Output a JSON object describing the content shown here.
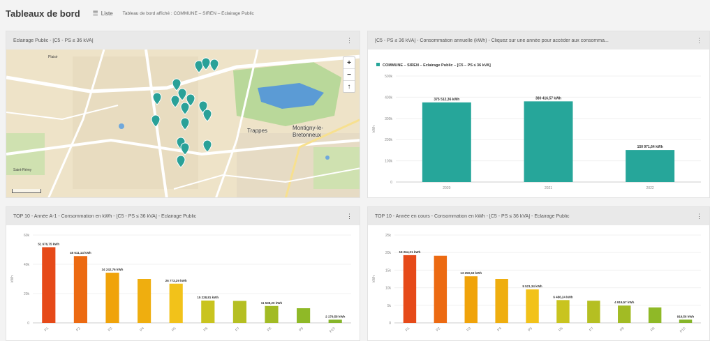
{
  "header": {
    "title": "Tableaux de bord",
    "list_icon": "list-icon",
    "list_label": "Liste",
    "breadcrumb": "Tableau de bord affiché : COMMUNE – SIREN – Eclairage Public"
  },
  "map_card": {
    "title": "Eclairage Public - [C5 - PS ≤ 36 kVA]",
    "zoom_in": "+",
    "zoom_out": "−",
    "reset": "↑",
    "places": {
      "trappes": "Trappes",
      "montigny": "Montigny-le-Bretonneux",
      "saint_remy": "Saint-Rémy",
      "plesis": "Plaisir"
    }
  },
  "annual_card": {
    "title": "[C5 - PS ≤ 36 kVA] - Consommation annuelle (kWh) - Cliquez sur une année pour accéder aux consomma...",
    "chart_data": {
      "type": "bar",
      "legend": "COMMUNE – SIREN – Eclairage Public – [C5 – PS ≤ 36 kVA]",
      "categories": [
        "2020",
        "2021",
        "2022"
      ],
      "values": [
        375512.36,
        380416.57,
        150971.64
      ],
      "labels": [
        "375 512,36 kWh",
        "380 416,57 kWh",
        "150 971,64 kWh"
      ],
      "ylabel": "kWh",
      "ylim": [
        0,
        500000
      ],
      "yticks": [
        "0",
        "100k",
        "200k",
        "300k",
        "400k",
        "500k"
      ],
      "color": "#26a69a"
    }
  },
  "top_prev_card": {
    "title": "TOP 10 - Année A-1 - Consommation en kWh - [C5 - PS ≤ 36 kVA] - Eclairage Public",
    "chart_data": {
      "type": "bar",
      "categories": [
        "P1",
        "P2",
        "P3",
        "P4",
        "P5",
        "P6",
        "P7",
        "P8",
        "P9",
        "P10"
      ],
      "values": [
        51676.75,
        45611.14,
        34242.76,
        30000,
        26773.29,
        15228.81,
        15000,
        11538.2,
        10000,
        2179.58
      ],
      "labels": [
        "51 676,75 kWh",
        "45 611,14 kWh",
        "34 242,76 kWh",
        "",
        "26 773,29 kWh",
        "15 228,81 kWh",
        "",
        "11 538,20 kWh",
        "",
        "2 179,58 kWh"
      ],
      "ylabel": "kWh",
      "ylim": [
        0,
        60000
      ],
      "yticks": [
        "0",
        "20k",
        "40k",
        "60k"
      ],
      "colors": [
        "#e64a19",
        "#ec6a12",
        "#f0a30a",
        "#efae0f",
        "#f2c21a",
        "#c9c41f",
        "#b5bf22",
        "#a2bb24",
        "#8fb927",
        "#86b52a"
      ]
    }
  },
  "top_cur_card": {
    "title": "TOP 10 - Année en cours - Consommation en kWh - [C5 - PS ≤ 36 kVA] - Eclairage Public",
    "chart_data": {
      "type": "bar",
      "categories": [
        "P1",
        "P2",
        "P3",
        "P4",
        "P5",
        "P6",
        "P7",
        "P8",
        "P9",
        "P10"
      ],
      "values": [
        19264.21,
        19100,
        13250.63,
        12500,
        9521.34,
        6486.24,
        6300,
        4919.57,
        4400,
        919.56
      ],
      "labels": [
        "19 264,21 kWh",
        "",
        "13 250,63 kWh",
        "",
        "9 521,34 kWh",
        "6 486,24 kWh",
        "",
        "4 919,57 kWh",
        "",
        "919,56 kWh"
      ],
      "ylabel": "kWh",
      "ylim": [
        0,
        25000
      ],
      "yticks": [
        "0",
        "5k",
        "10k",
        "15k",
        "20k",
        "25k"
      ],
      "colors": [
        "#e64a19",
        "#ec6a12",
        "#f0a30a",
        "#efae0f",
        "#f2c21a",
        "#c9c41f",
        "#b5bf22",
        "#a2bb24",
        "#8fb927",
        "#86b52a"
      ]
    }
  }
}
